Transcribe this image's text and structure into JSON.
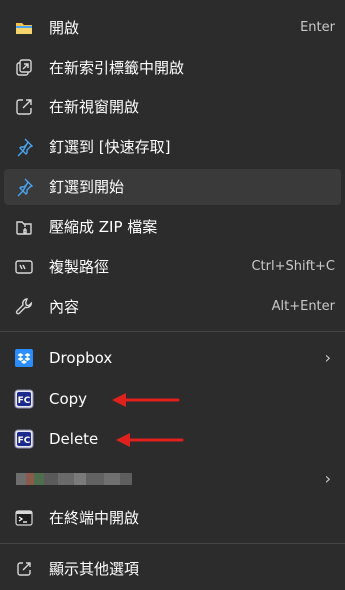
{
  "menu": {
    "items": [
      {
        "label": "開啟",
        "shortcut": "Enter",
        "icon": "folder-icon"
      },
      {
        "label": "在新索引標籤中開啟",
        "shortcut": "",
        "icon": "open-in-new-tab-icon"
      },
      {
        "label": "在新視窗開啟",
        "shortcut": "",
        "icon": "open-in-new-window-icon"
      },
      {
        "label": "釘選到 [快速存取]",
        "shortcut": "",
        "icon": "pin-icon"
      },
      {
        "label": "釘選到開始",
        "shortcut": "",
        "icon": "pin-icon"
      },
      {
        "label": "壓縮成 ZIP 檔案",
        "shortcut": "",
        "icon": "zip-icon"
      },
      {
        "label": "複製路徑",
        "shortcut": "Ctrl+Shift+C",
        "icon": "copy-path-icon"
      },
      {
        "label": "內容",
        "shortcut": "Alt+Enter",
        "icon": "wrench-icon"
      },
      {
        "label": "Dropbox",
        "shortcut": "",
        "icon": "dropbox-icon"
      },
      {
        "label": "Copy",
        "shortcut": "",
        "icon": "fastcopy-icon"
      },
      {
        "label": "Delete",
        "shortcut": "",
        "icon": "fastcopy-icon"
      },
      {
        "label": "",
        "shortcut": "",
        "icon": "blurred-app-icon"
      },
      {
        "label": "在終端中開啟",
        "shortcut": "",
        "icon": "terminal-icon"
      },
      {
        "label": "顯示其他選項",
        "shortcut": "",
        "icon": "more-options-icon"
      }
    ],
    "fc_badge": "FC",
    "chevron": "›"
  },
  "colors": {
    "background": "#2c2c2c",
    "hover": "#3a3a3a",
    "separator": "#454545",
    "accent_blue": "#4aa3f0",
    "folder_yellow": "#f2c14e",
    "dropbox_blue": "#2b8cff",
    "arrow_red": "#e0201c"
  }
}
